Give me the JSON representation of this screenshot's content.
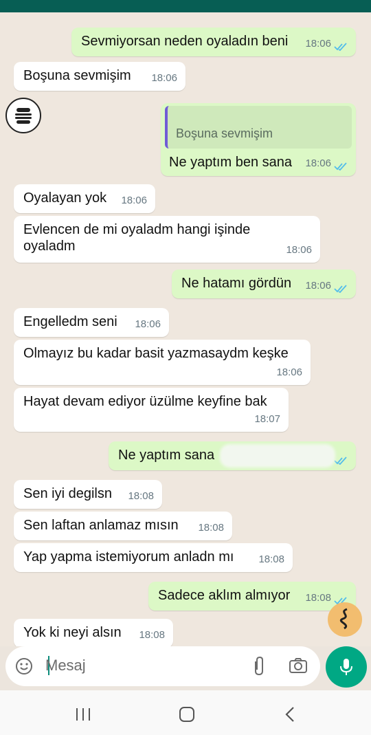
{
  "input": {
    "placeholder": "Mesaj"
  },
  "messages": [
    {
      "text": "Sevmiyorsan neden oyaladın beni",
      "time": "18:06",
      "dir": "out"
    },
    {
      "text": "Boşuna sevmişim",
      "time": "18:06",
      "dir": "in"
    },
    {
      "quote": "Boşuna sevmişim",
      "text": "Ne yaptım ben sana",
      "time": "18:06",
      "dir": "out"
    },
    {
      "text": "Oyalayan yok",
      "time": "18:06",
      "dir": "in"
    },
    {
      "text": "Evlencen de mi oyaladm hangi işinde oyaladm",
      "time": "18:06",
      "dir": "in"
    },
    {
      "text": "Ne hatamı gördün",
      "time": "18:06",
      "dir": "out"
    },
    {
      "text": "Engelledm seni",
      "time": "18:06",
      "dir": "in"
    },
    {
      "text": "Olmayız bu kadar basit yazmasaydm keşke",
      "time": "18:06",
      "dir": "in"
    },
    {
      "text": "Hayat devam ediyor üzülme keyfine bak",
      "time": "18:07",
      "dir": "in"
    },
    {
      "text": "Ne yaptım sana",
      "time": "",
      "dir": "out"
    },
    {
      "text": "Sen iyi degilsn",
      "time": "18:08",
      "dir": "in"
    },
    {
      "text": "Sen laftan anlamaz mısın",
      "time": "18:08",
      "dir": "in"
    },
    {
      "text": "Yap yapma istemiyorum anladn mı",
      "time": "18:08",
      "dir": "in"
    },
    {
      "text": "Sadece aklım almıyor",
      "time": "18:08",
      "dir": "out"
    },
    {
      "text": "Yok ki neyi alsın",
      "time": "18:08",
      "dir": "in"
    }
  ],
  "icons": {
    "emoji": "emoji-icon",
    "attach": "paperclip-icon",
    "camera": "camera-icon",
    "mic": "microphone-icon",
    "read_receipt": "double-check-icon",
    "nav_recent": "recent-apps-icon",
    "nav_home": "home-icon",
    "nav_back": "back-icon"
  },
  "colors": {
    "header": "#075e54",
    "outgoing_bubble": "#dcf8c6",
    "incoming_bubble": "#ffffff",
    "accent": "#00a884",
    "ticks": "#53bdeb"
  }
}
